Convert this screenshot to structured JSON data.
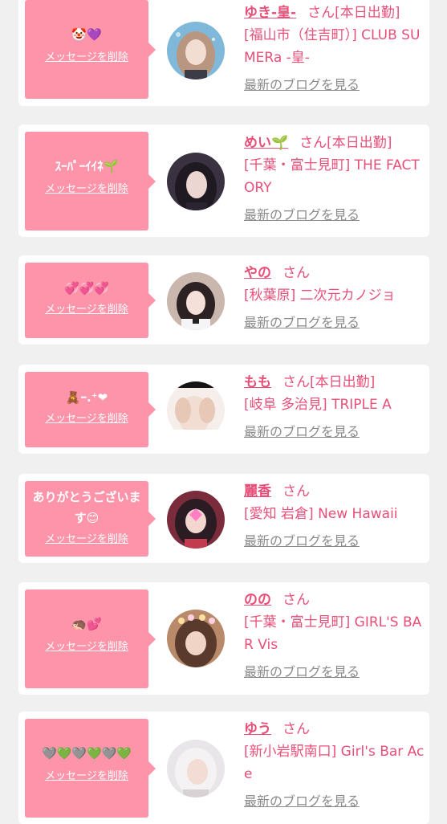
{
  "colors": {
    "bubble": "#fd94a9",
    "accent_text": "#e84f78",
    "link_gray": "#8a8a8a",
    "background": "#f0f0f0",
    "card": "#ffffff"
  },
  "delete_label": "メッセージを削除",
  "blog_label": "最新のブログを見る",
  "san_label": "さん",
  "cards": [
    {
      "message": "🤡💜",
      "name": "ゆき-皇-",
      "status": "[本日出勤]",
      "shop": "[福山市（住吉町）] CLUB SUMERa -皇-"
    },
    {
      "message": "ｽｰﾊﾟｰｲｲﾈ🌱",
      "name": "めい🌱",
      "status": "[本日出勤]",
      "shop": "[千葉・富士見町] THE FACTORY"
    },
    {
      "message": "💞💞💞",
      "name": "やの",
      "status": "",
      "shop": "[秋葉原] 二次元カノジョ"
    },
    {
      "message": "🧸ｰ.⁺❤",
      "name": "もも",
      "status": "[本日出勤]",
      "shop": "[岐阜 多治見] TRIPLE A"
    },
    {
      "message": "ありがとうございます😊",
      "name": "麗香",
      "status": "",
      "shop": "[愛知 岩倉] New Hawaii"
    },
    {
      "message": "🦔💕",
      "name": "のの",
      "status": "",
      "shop": "[千葉・富士見町] GIRL'S BAR Vis"
    },
    {
      "message": "🩶💚🩶💚🩶💚",
      "name": "ゆう",
      "status": "",
      "shop": "[新小岩駅南口] Girl's Bar Ace"
    }
  ]
}
